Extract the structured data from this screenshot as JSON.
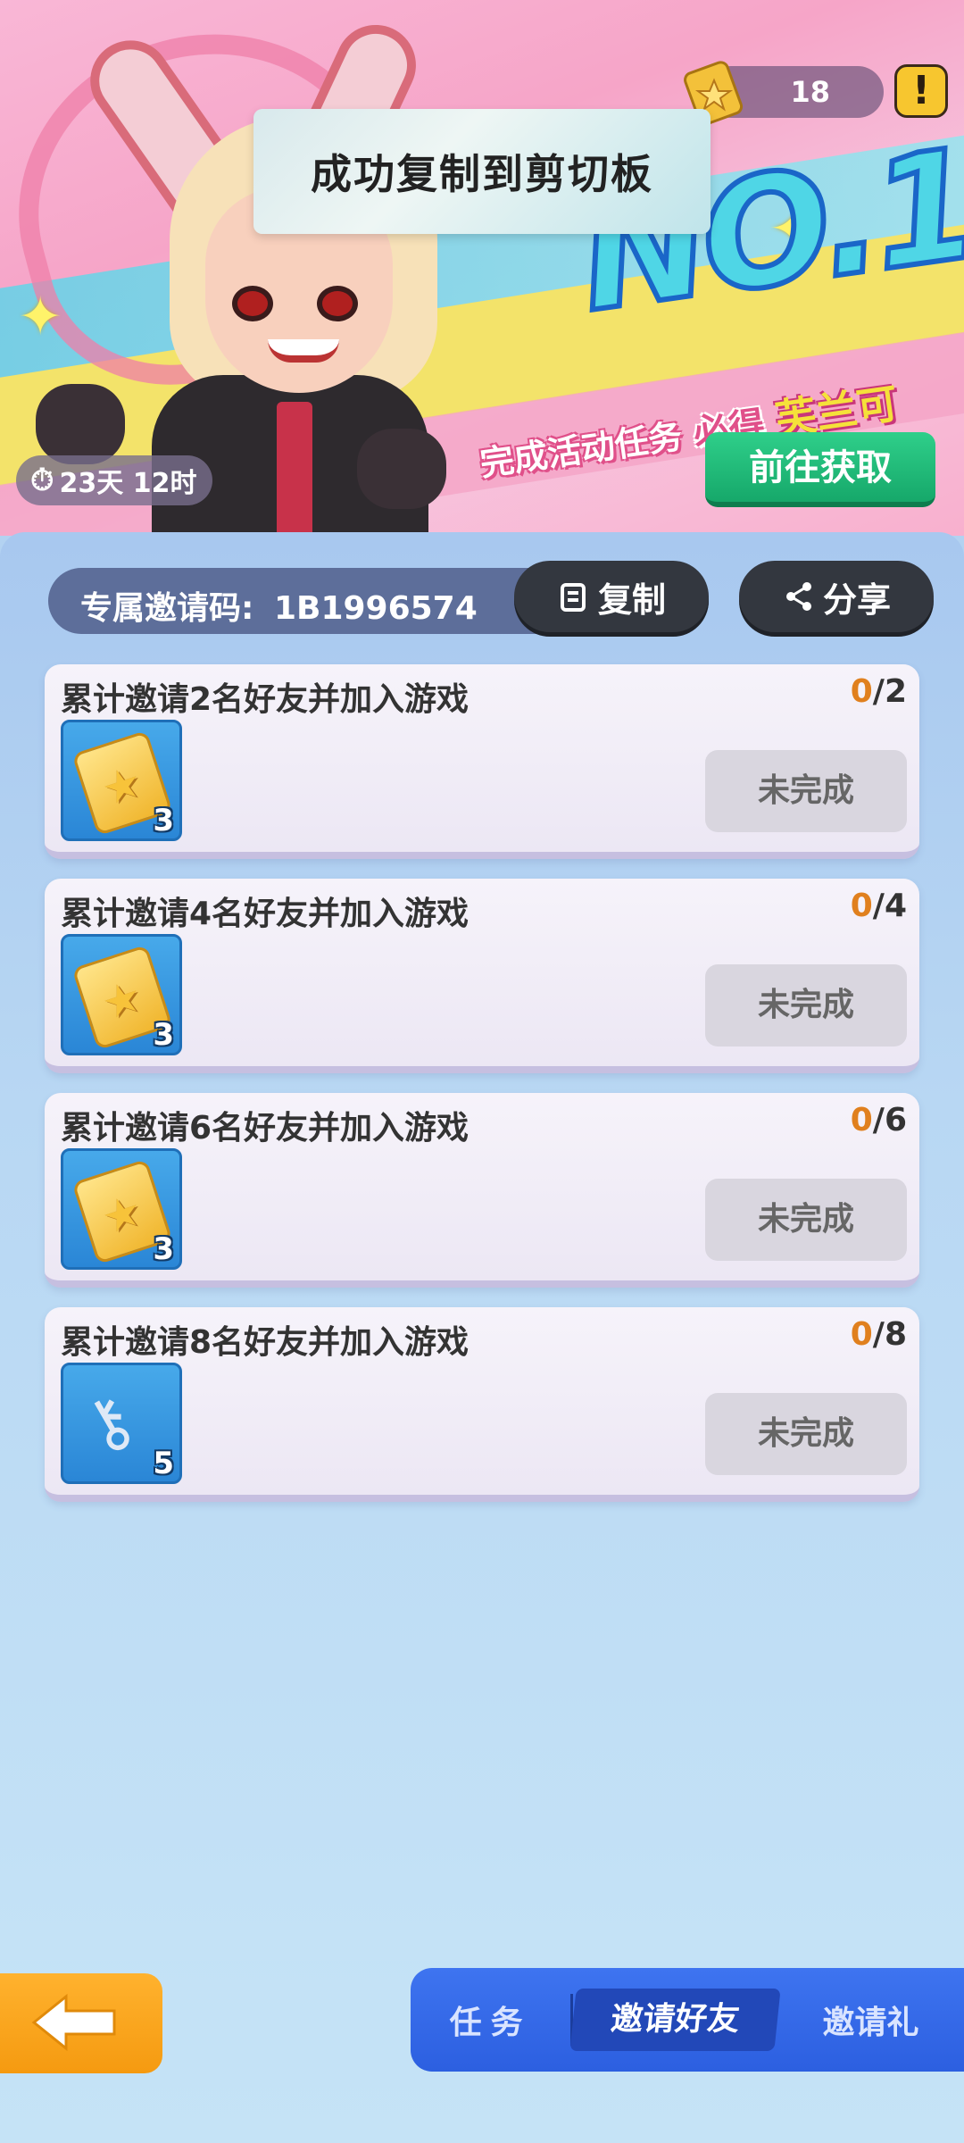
{
  "banner": {
    "currency_count": "18",
    "alert_symbol": "!",
    "headline": "NO.1",
    "tagline_part1": "完成活动任务",
    "tagline_part2": "必得",
    "tagline_part3": "芙兰可",
    "timer": "23天 12时",
    "go_button": "前往获取"
  },
  "toast": {
    "message": "成功复制到剪切板"
  },
  "invite": {
    "code_label": "专属邀请码:",
    "code_value": "1B1996574",
    "copy_button": "复制",
    "share_button": "分享"
  },
  "tasks": [
    {
      "title": "累计邀请2名好友并加入游戏",
      "current": "0",
      "total": "/2",
      "reward_qty": "3",
      "reward_icon": "star-ticket-icon",
      "status": "未完成"
    },
    {
      "title": "累计邀请4名好友并加入游戏",
      "current": "0",
      "total": "/4",
      "reward_qty": "3",
      "reward_icon": "star-ticket-icon",
      "status": "未完成"
    },
    {
      "title": "累计邀请6名好友并加入游戏",
      "current": "0",
      "total": "/6",
      "reward_qty": "3",
      "reward_icon": "star-ticket-icon",
      "status": "未完成"
    },
    {
      "title": "累计邀请8名好友并加入游戏",
      "current": "0",
      "total": "/8",
      "reward_qty": "5",
      "reward_icon": "keys-icon",
      "status": "未完成"
    }
  ],
  "bottom_nav": {
    "back_label": "Back",
    "tabs": [
      "任务",
      "邀请好友",
      "邀请礼"
    ],
    "active_tab": "邀请好友"
  },
  "colors": {
    "accent_green": "#16a86a",
    "progress_orange": "#e0801e",
    "tab_blue": "#2c5fe0",
    "back_orange": "#f59a10"
  }
}
